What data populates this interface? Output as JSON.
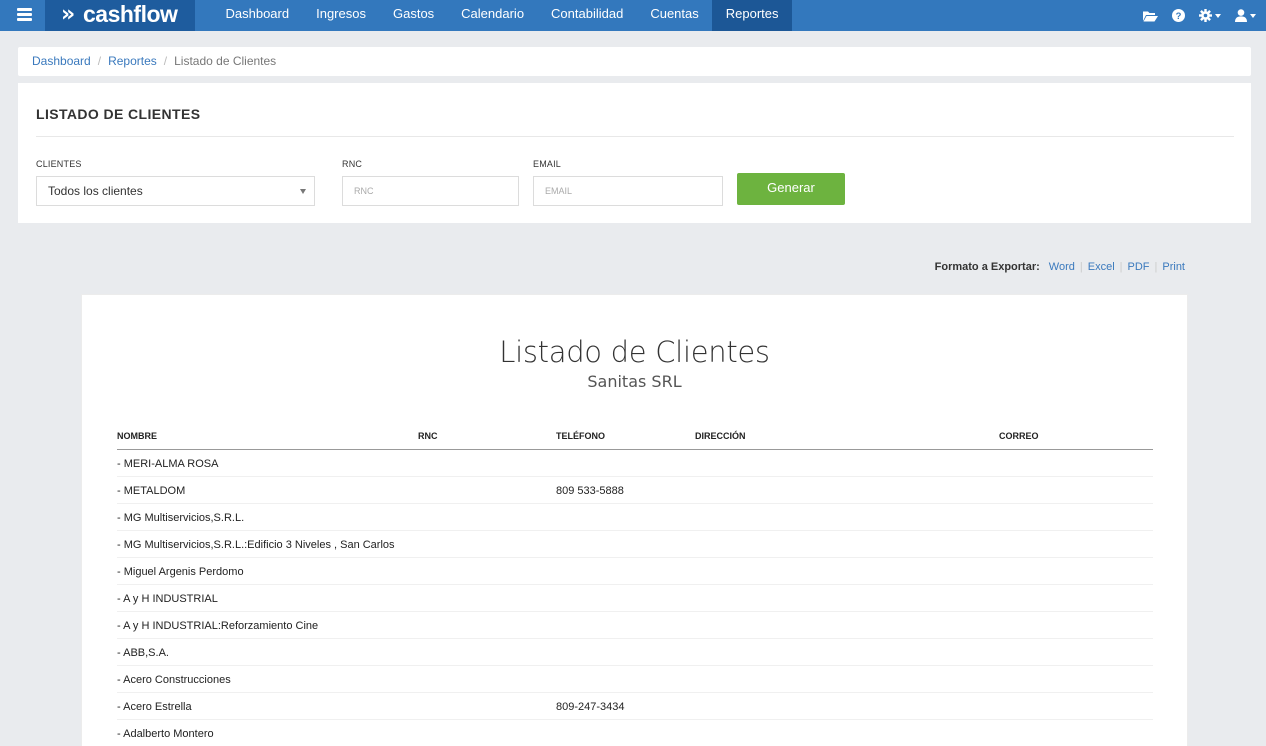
{
  "app": {
    "brand": "cashflow",
    "brand_mark": "»"
  },
  "nav": {
    "items": [
      {
        "label": "Dashboard"
      },
      {
        "label": "Ingresos"
      },
      {
        "label": "Gastos"
      },
      {
        "label": "Calendario"
      },
      {
        "label": "Contabilidad"
      },
      {
        "label": "Cuentas"
      },
      {
        "label": "Reportes"
      }
    ],
    "active": "Reportes",
    "right_icons": [
      "folder-open-icon",
      "help-icon",
      "gear-icon",
      "user-icon"
    ]
  },
  "breadcrumb": {
    "items": [
      "Dashboard",
      "Reportes"
    ],
    "current": "Listado de Clientes",
    "separator": "/"
  },
  "filters": {
    "title": "LISTADO DE CLIENTES",
    "clientes_label": "CLIENTES",
    "clientes_value": "Todos los clientes",
    "rnc_label": "RNC",
    "rnc_placeholder": "RNC",
    "email_label": "EMAIL",
    "email_placeholder": "EMAIL",
    "generate_label": "Generar"
  },
  "export": {
    "label": "Formato a Exportar:",
    "formats": [
      "Word",
      "Excel",
      "PDF",
      "Print"
    ]
  },
  "report": {
    "title": "Listado de Clientes",
    "subtitle": "Sanitas SRL",
    "columns": {
      "nombre": "NOMBRE",
      "rnc": "RNC",
      "telefono": "TELÉFONO",
      "direccion": "DIRECCIÓN",
      "correo": "CORREO"
    },
    "rows": [
      {
        "nombre": "- MERI-ALMA ROSA",
        "rnc": "",
        "telefono": "",
        "direccion": "",
        "correo": ""
      },
      {
        "nombre": "- METALDOM",
        "rnc": "",
        "telefono": "809 533-5888",
        "direccion": "",
        "correo": ""
      },
      {
        "nombre": "- MG Multiservicios,S.R.L.",
        "rnc": "",
        "telefono": "",
        "direccion": "",
        "correo": ""
      },
      {
        "nombre": "- MG Multiservicios,S.R.L.:Edificio 3 Niveles , San Carlos",
        "rnc": "",
        "telefono": "",
        "direccion": "",
        "correo": ""
      },
      {
        "nombre": "- Miguel Argenis Perdomo",
        "rnc": "",
        "telefono": "",
        "direccion": "",
        "correo": ""
      },
      {
        "nombre": "- A y H INDUSTRIAL",
        "rnc": "",
        "telefono": "",
        "direccion": "",
        "correo": ""
      },
      {
        "nombre": "- A y H INDUSTRIAL:Reforzamiento Cine",
        "rnc": "",
        "telefono": "",
        "direccion": "",
        "correo": ""
      },
      {
        "nombre": "- ABB,S.A.",
        "rnc": "",
        "telefono": "",
        "direccion": "",
        "correo": ""
      },
      {
        "nombre": "- Acero Construcciones",
        "rnc": "",
        "telefono": "",
        "direccion": "",
        "correo": ""
      },
      {
        "nombre": "- Acero Estrella",
        "rnc": "",
        "telefono": "809-247-3434",
        "direccion": "",
        "correo": ""
      },
      {
        "nombre": "- Adalberto Montero",
        "rnc": "",
        "telefono": "",
        "direccion": "",
        "correo": ""
      }
    ]
  },
  "colors": {
    "nav_bg": "#3378bd",
    "brand_bg": "#1e5c9e",
    "nav_active": "#1c5796",
    "link": "#3a79bd",
    "generate_button": "#6db33f",
    "page_bg": "#e9ebee"
  }
}
